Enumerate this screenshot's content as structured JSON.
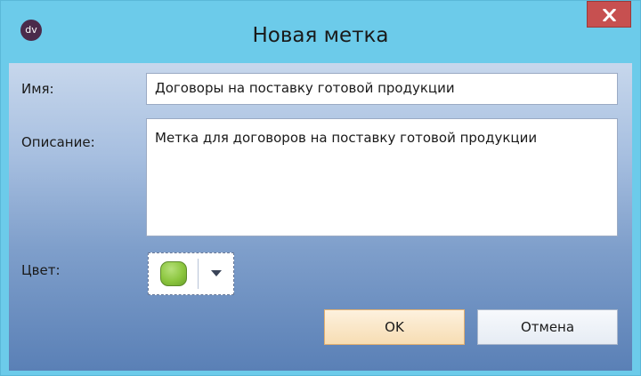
{
  "window": {
    "title": "Новая метка",
    "app_icon_text": "dv",
    "close_icon": "close-x-icon"
  },
  "form": {
    "name_label": "Имя:",
    "name_value": "Договоры на поставку готовой продукции",
    "description_label": "Описание:",
    "description_value": "Метка для договоров на поставку готовой продукции",
    "color_label": "Цвет:",
    "color_value": "#8cc63f"
  },
  "buttons": {
    "ok_label": "OK",
    "cancel_label": "Отмена"
  },
  "colors": {
    "titlebar": "#6ccbea",
    "close_button": "#c75050",
    "ok_button_border": "#e3b070"
  }
}
